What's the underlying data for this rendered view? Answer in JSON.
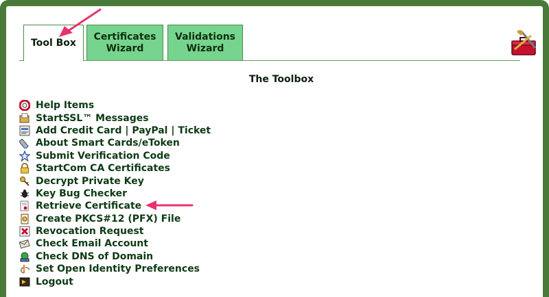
{
  "tabs": [
    {
      "label_line1": "Tool Box",
      "label_line2": "",
      "active": true
    },
    {
      "label_line1": "Certificates",
      "label_line2": "Wizard",
      "active": false
    },
    {
      "label_line1": "Validations",
      "label_line2": "Wizard",
      "active": false
    }
  ],
  "page_title": "The Toolbox",
  "menu": [
    {
      "label": "Help Items",
      "icon": "help-lifebuoy-icon"
    },
    {
      "label": "StartSSL™ Messages",
      "icon": "message-icon"
    },
    {
      "label": "Add Credit Card | PayPal | Ticket",
      "icon": "credit-card-icon"
    },
    {
      "label": "About Smart Cards/eToken",
      "icon": "smart-card-icon"
    },
    {
      "label": "Submit Verification Code",
      "icon": "star-icon"
    },
    {
      "label": "StartCom CA Certificates",
      "icon": "lock-icon"
    },
    {
      "label": "Decrypt Private Key",
      "icon": "key-icon"
    },
    {
      "label": "Key Bug Checker",
      "icon": "bug-icon"
    },
    {
      "label": "Retrieve Certificate",
      "icon": "certificate-icon"
    },
    {
      "label": "Create PKCS#12 (PFX) File",
      "icon": "file-seal-icon"
    },
    {
      "label": "Revocation Request",
      "icon": "revoke-icon"
    },
    {
      "label": "Check Email Account",
      "icon": "email-icon"
    },
    {
      "label": "Check DNS of Domain",
      "icon": "dns-icon"
    },
    {
      "label": "Set Open Identity Preferences",
      "icon": "openid-icon"
    },
    {
      "label": "Logout",
      "icon": "logout-icon"
    }
  ],
  "colors": {
    "frame": "#4a7a3a",
    "tab_inactive": "#77d48f",
    "text": "#0d3a14",
    "arrow": "#e8336d"
  }
}
